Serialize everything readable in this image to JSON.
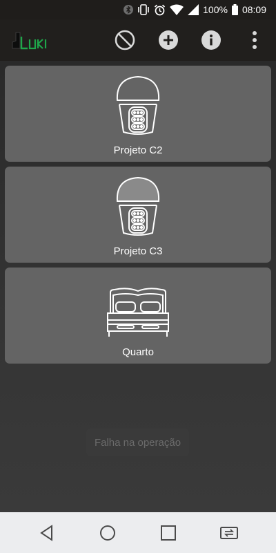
{
  "status_bar": {
    "battery_percent": "100%",
    "time": "08:09",
    "icons": [
      "bluetooth-icon",
      "vibrate-icon",
      "alarm-icon",
      "wifi-icon",
      "signal-icon",
      "battery-icon"
    ]
  },
  "app_bar": {
    "logo_text": "LUKI",
    "actions": [
      "block-icon",
      "add-circle-icon",
      "info-circle-icon",
      "more-vert-icon"
    ]
  },
  "cards": [
    {
      "label": "Projeto C2",
      "icon": "smart-lamp-icon"
    },
    {
      "label": "Projeto C3",
      "icon": "smart-lamp-icon"
    },
    {
      "label": "Quarto",
      "icon": "bed-icon"
    }
  ],
  "toast": {
    "message": "Falha na operação"
  },
  "nav_bar": {
    "buttons": [
      "back-icon",
      "home-icon",
      "recents-icon",
      "switch-app-icon"
    ]
  },
  "colors": {
    "card_bg": "#646464",
    "appbar_bg": "#211f1d",
    "navbar_bg": "#ecedef",
    "logo_green": "#1fa64a"
  }
}
